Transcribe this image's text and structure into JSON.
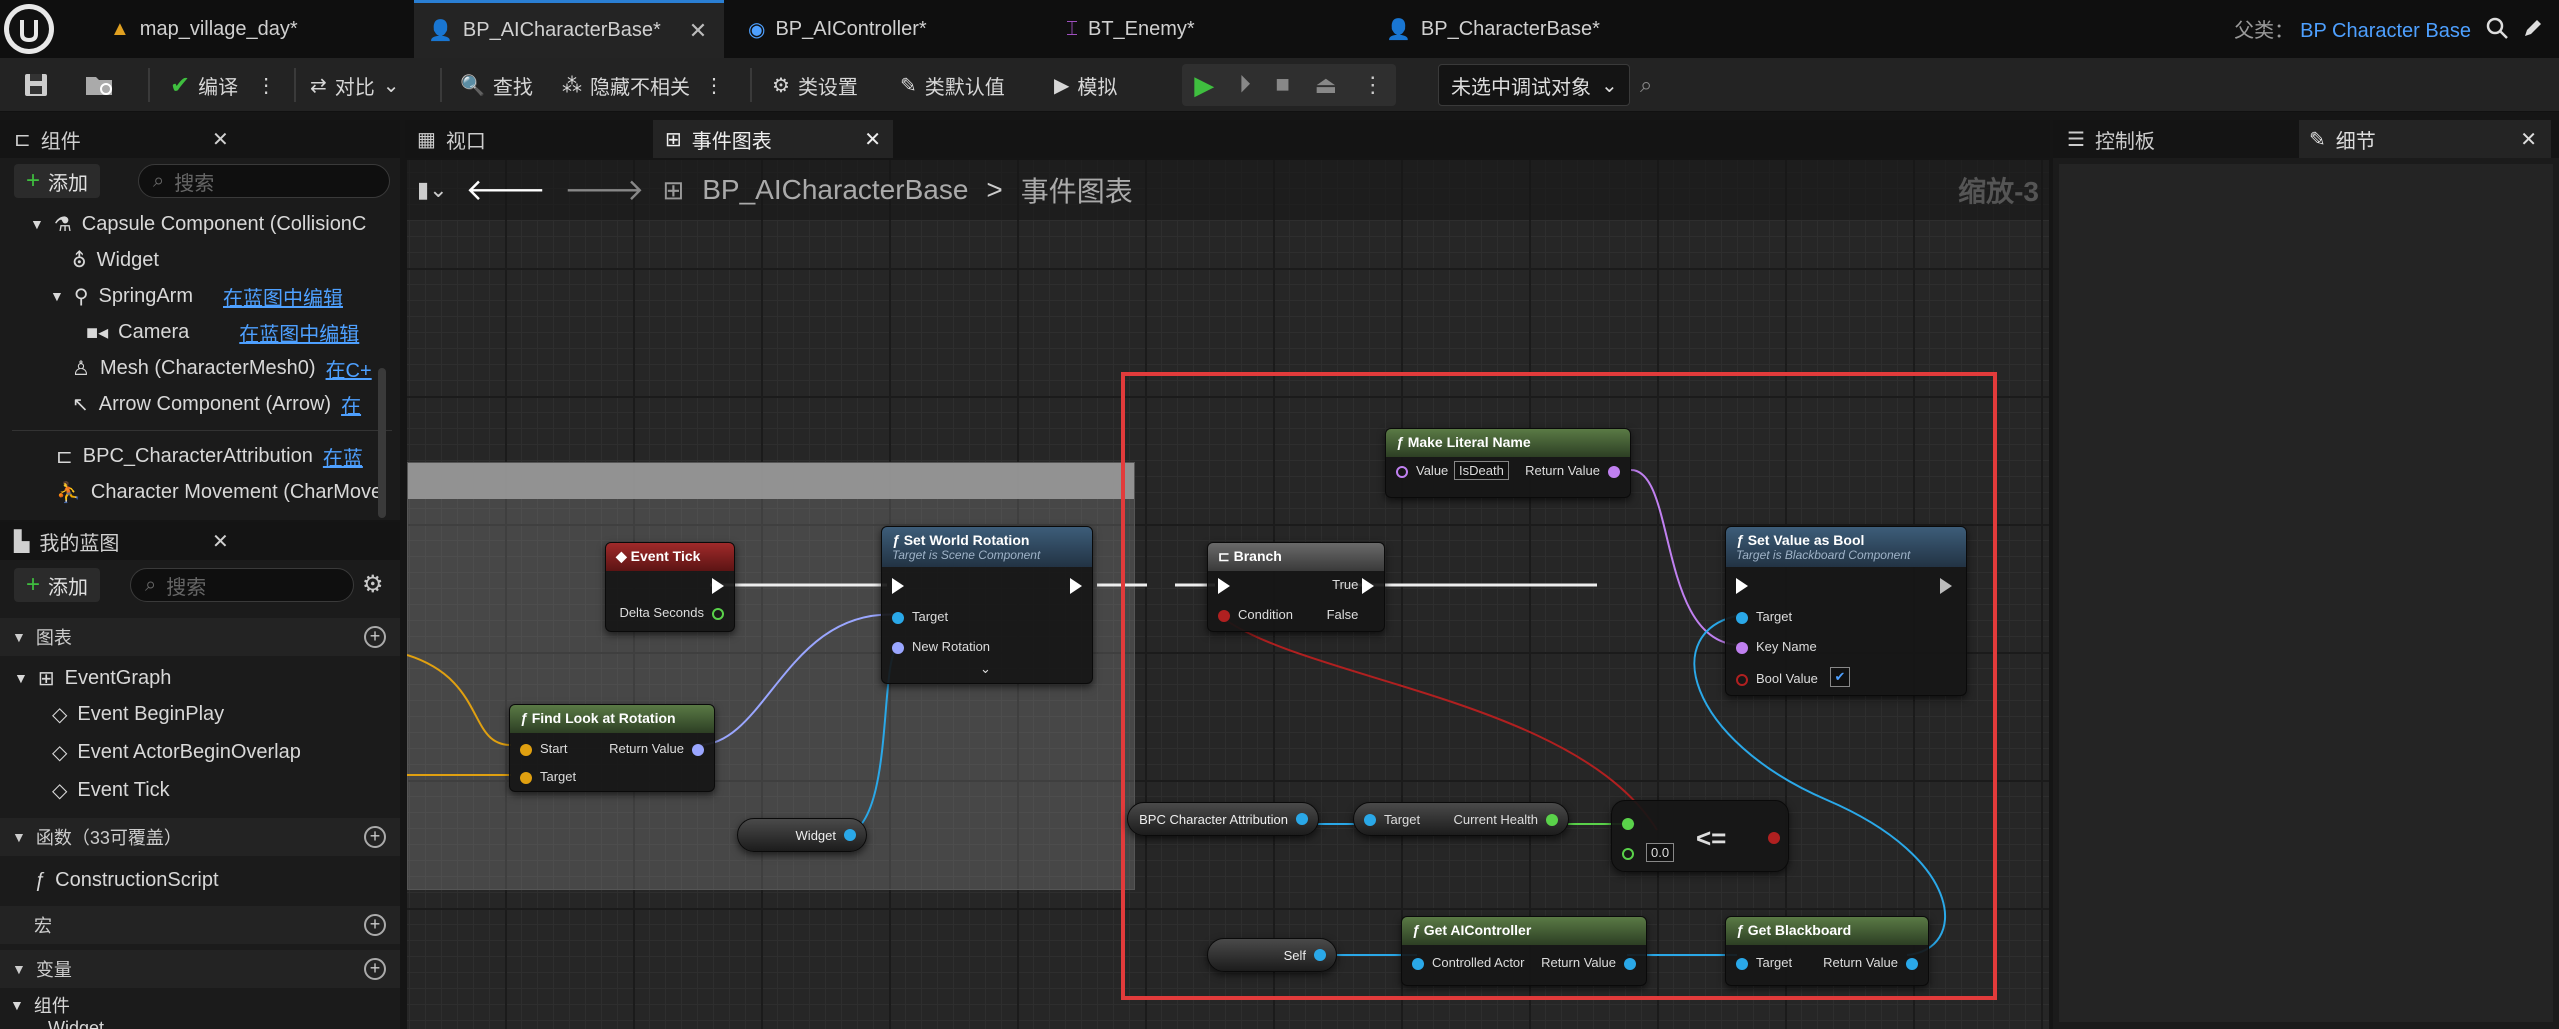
{
  "tabs": [
    {
      "label": "map_village_day*"
    },
    {
      "label": "BP_AICharacterBase*"
    },
    {
      "label": "BP_AIController*"
    },
    {
      "label": "BT_Enemy*"
    },
    {
      "label": "BP_CharacterBase*"
    }
  ],
  "parent_class": {
    "label": "父类：",
    "value": "BP Character Base"
  },
  "toolbar": {
    "compile": "编译",
    "diff": "对比",
    "find": "查找",
    "hide_unrelated": "隐藏不相关",
    "class_settings": "类设置",
    "class_defaults": "类默认值",
    "simulate": "模拟",
    "debug_object": "未选中调试对象"
  },
  "components_panel": {
    "title": "组件",
    "add": "添加",
    "search_placeholder": "搜索",
    "items": [
      {
        "label": "Capsule Component (CollisionC",
        "link": ""
      },
      {
        "label": "Widget",
        "link": ""
      },
      {
        "label": "SpringArm",
        "link": "在蓝图中编辑"
      },
      {
        "label": "Camera",
        "link": "在蓝图中编辑"
      },
      {
        "label": "Mesh (CharacterMesh0)",
        "link": "在C+"
      },
      {
        "label": "Arrow Component (Arrow)",
        "link": "在"
      },
      {
        "label": "BPC_CharacterAttribution",
        "link": "在蓝"
      },
      {
        "label": "Character Movement (CharMove",
        "link": ""
      }
    ]
  },
  "my_blueprint": {
    "title": "我的蓝图",
    "add": "添加",
    "search_placeholder": "搜索",
    "graphs_section": "图表",
    "event_graph": "EventGraph",
    "events": [
      "Event BeginPlay",
      "Event ActorBeginOverlap",
      "Event Tick"
    ],
    "functions_section": "函数（33可覆盖）",
    "construction_script": "ConstructionScript",
    "macros_section": "宏",
    "variables_section": "变量",
    "components_section": "组件",
    "clipped_item": "Widget"
  },
  "graph_tabs": {
    "viewport": "视口",
    "event_graph": "事件图表"
  },
  "breadcrumb": {
    "blueprint": "BP_AICharacterBase",
    "sep": ">",
    "graph": "事件图表"
  },
  "zoom": "缩放-3",
  "right_tabs": {
    "control_panel": "控制板",
    "details": "细节"
  },
  "nodes": {
    "event_tick": {
      "title": "Event Tick",
      "pin": "Delta Seconds"
    },
    "set_world_rotation": {
      "title": "Set World Rotation",
      "subtitle": "Target is Scene Component",
      "pins": [
        "Target",
        "New Rotation"
      ]
    },
    "find_look_at": {
      "title": "Find Look at Rotation",
      "pins": [
        "Start",
        "Target",
        "Return Value"
      ]
    },
    "widget_var": "Widget",
    "make_literal_name": {
      "title": "Make Literal Name",
      "value_label": "Value",
      "value": "IsDeath",
      "out": "Return Value"
    },
    "branch": {
      "title": "Branch",
      "condition": "Condition",
      "true": "True",
      "false": "False"
    },
    "set_value_as_bool": {
      "title": "Set Value as Bool",
      "subtitle": "Target is Blackboard Component",
      "pins": [
        "Target",
        "Key Name",
        "Bool Value"
      ]
    },
    "bpc_attr": "BPC Character Attribution",
    "get_health": {
      "target": "Target",
      "out": "Current Health"
    },
    "compare": {
      "op": "<=",
      "value": "0.0"
    },
    "self": "Self",
    "get_ai_controller": {
      "title": "Get AIController",
      "in": "Controlled Actor",
      "out": "Return Value"
    },
    "get_blackboard": {
      "title": "Get Blackboard",
      "in": "Target",
      "out": "Return Value"
    }
  },
  "colors": {
    "accent": "#2a7fd4",
    "highlight_box": "#e23b3b",
    "link": "#4ea0ff",
    "play": "#3fbf3f"
  }
}
